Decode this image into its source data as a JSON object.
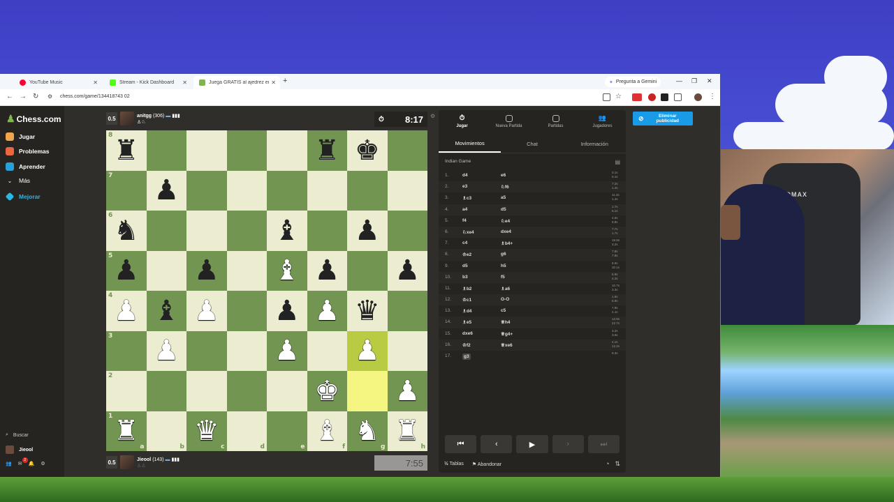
{
  "browser": {
    "tabs": [
      {
        "title": "YouTube Music",
        "color": "#ff0033"
      },
      {
        "title": "Stream - Kick Dashboard",
        "color": "#53fc18"
      },
      {
        "title": "Juega GRATIS al ajedrez en líne",
        "color": "#81b64c"
      }
    ],
    "new_tab": "+",
    "gemini_label": "Pregunta a Gemini",
    "url": "chess.com/game/134418743 02"
  },
  "site": {
    "logo": "Chess.com",
    "nav": [
      {
        "label": "Jugar",
        "color": "#f0a44b"
      },
      {
        "label": "Problemas",
        "color": "#e9683f"
      },
      {
        "label": "Aprender",
        "color": "#2aa0d8"
      },
      {
        "label": "Más",
        "color": "#888888"
      },
      {
        "label": "Mejorar",
        "color": "#29b7e5"
      }
    ],
    "search": "Buscar",
    "user": "Jieool",
    "notifications": "2"
  },
  "top_player": {
    "score": "0.5",
    "name": "anitgg",
    "rating": "(306)",
    "clock": "8:17"
  },
  "bottom_player": {
    "score": "0.5",
    "name": "Jieool",
    "rating": "(143)",
    "clock": "7:55"
  },
  "board": {
    "ranks": [
      "8",
      "7",
      "6",
      "5",
      "4",
      "3",
      "2",
      "1"
    ],
    "files": [
      "a",
      "b",
      "c",
      "d",
      "e",
      "f",
      "g",
      "h"
    ],
    "position": [
      [
        "bR",
        "",
        "",
        "",
        "",
        "bR",
        "bK",
        ""
      ],
      [
        "",
        "bP",
        "",
        "",
        "",
        "",
        "",
        ""
      ],
      [
        "bN",
        "",
        "",
        "",
        "bB",
        "",
        "bP",
        ""
      ],
      [
        "bP",
        "",
        "bP",
        "",
        "wB",
        "bP",
        "",
        "bP"
      ],
      [
        "wP",
        "bB",
        "wP",
        "",
        "bP",
        "wP",
        "bQ",
        ""
      ],
      [
        "",
        "wP",
        "",
        "",
        "wP",
        "",
        "wP",
        ""
      ],
      [
        "",
        "",
        "",
        "",
        "",
        "wK",
        "",
        "wP"
      ],
      [
        "wR",
        "",
        "wQ",
        "",
        "",
        "wB",
        "wN",
        "wR"
      ]
    ],
    "highlights": [
      "g3",
      "g2"
    ]
  },
  "panel": {
    "top_tabs": [
      "Jugar",
      "Nueva Partida",
      "Partidas",
      "Jugadores"
    ],
    "sub_tabs": [
      "Movimientos",
      "Chat",
      "Información"
    ],
    "opening": "Indian Game",
    "moves": [
      {
        "n": "1.",
        "w": "d4",
        "b": "e6",
        "tw": "0.1s",
        "tb": "0.1s"
      },
      {
        "n": "2.",
        "w": "e3",
        "b": "♘f6",
        "tw": "7.2s",
        "tb": "1.4s"
      },
      {
        "n": "3.",
        "w": "♗c3",
        "b": "a5",
        "tw": "11.4s",
        "tb": "1.4s"
      },
      {
        "n": "4.",
        "w": "a4",
        "b": "d5",
        "tw": "1.7s",
        "tb": "6.1s"
      },
      {
        "n": "5.",
        "w": "f4",
        "b": "♘e4",
        "tw": "4.6s",
        "tb": "9.8s"
      },
      {
        "n": "6.",
        "w": "♘xe4",
        "b": "dxe4",
        "tw": "7.7s",
        "tb": "1.7s"
      },
      {
        "n": "7.",
        "w": "c4",
        "b": "♗b4+",
        "tw": "18.9s",
        "tb": "3.2s"
      },
      {
        "n": "8.",
        "w": "♔e2",
        "b": "g6",
        "tw": "7.8s",
        "tb": "7.8s"
      },
      {
        "n": "9.",
        "w": "d5",
        "b": "h5",
        "tw": "8.9s",
        "tb": "10.1s"
      },
      {
        "n": "10.",
        "w": "b3",
        "b": "f5",
        "tw": "6.9s",
        "tb": "4.2s"
      },
      {
        "n": "11.",
        "w": "♗b2",
        "b": "♗a6",
        "tw": "10.7s",
        "tb": "3.3s"
      },
      {
        "n": "12.",
        "w": "♔c1",
        "b": "O-O",
        "tw": "1.6s",
        "tb": "5.9s"
      },
      {
        "n": "13.",
        "w": "♗d4",
        "b": "c5",
        "tw": "7.8s",
        "tb": "4.1s"
      },
      {
        "n": "14.",
        "w": "♗e5",
        "b": "♕h4",
        "tw": "12.9s",
        "tb": "22.7s"
      },
      {
        "n": "15.",
        "w": "dxe6",
        "b": "♕g4+",
        "tw": "3.2s",
        "tb": "3.5s"
      },
      {
        "n": "16.",
        "w": "♔f2",
        "b": "♕xe6",
        "tw": "4.1s",
        "tb": "12.2s"
      },
      {
        "n": "17.",
        "w": "g3",
        "b": "",
        "tw": "9.3s",
        "tb": ""
      }
    ],
    "controls": [
      "⏮",
      "‹",
      "▶",
      "›",
      "⏭"
    ],
    "draw_label": "Tablas",
    "draw_prefix": "½",
    "resign_label": "Abandonar"
  },
  "ad": {
    "label_line1": "Eliminar",
    "label_line2": "publicidad"
  },
  "webcam": {
    "brand": "RAIDMAX"
  }
}
